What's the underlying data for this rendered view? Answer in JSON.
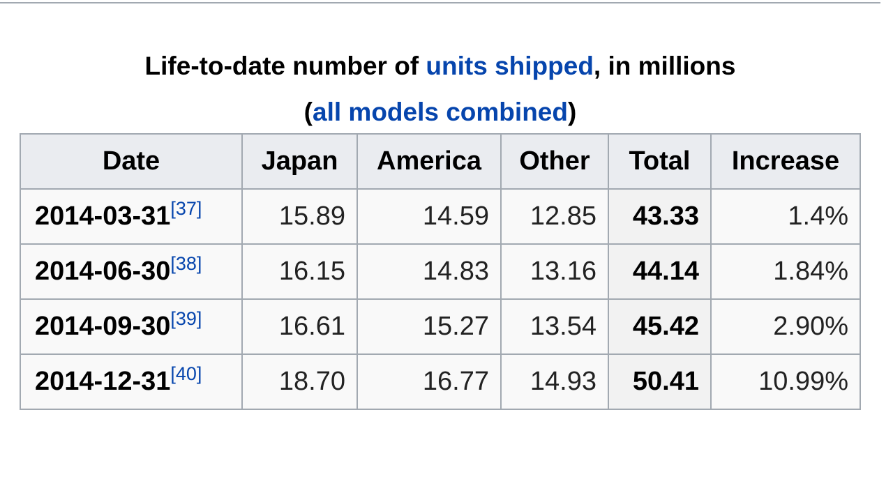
{
  "caption": {
    "prefix": "Life-to-date number of ",
    "link1": "units shipped",
    "middle": ", in millions",
    "open_paren": "(",
    "link2": "all models combined",
    "close_paren": ")"
  },
  "table": {
    "headers": [
      "Date",
      "Japan",
      "America",
      "Other",
      "Total",
      "Increase"
    ],
    "rows": [
      {
        "date": "2014-03-31",
        "ref": "[37]",
        "japan": "15.89",
        "america": "14.59",
        "other": "12.85",
        "total": "43.33",
        "increase": "1.4%"
      },
      {
        "date": "2014-06-30",
        "ref": "[38]",
        "japan": "16.15",
        "america": "14.83",
        "other": "13.16",
        "total": "44.14",
        "increase": "1.84%"
      },
      {
        "date": "2014-09-30",
        "ref": "[39]",
        "japan": "16.61",
        "america": "15.27",
        "other": "13.54",
        "total": "45.42",
        "increase": "2.90%"
      },
      {
        "date": "2014-12-31",
        "ref": "[40]",
        "japan": "18.70",
        "america": "16.77",
        "other": "14.93",
        "total": "50.41",
        "increase": "10.99%"
      }
    ]
  },
  "colors": {
    "link": "#0645ad",
    "border": "#a2a9b1",
    "header_bg": "#eaecf0",
    "cell_bg": "#f9f9f9"
  }
}
